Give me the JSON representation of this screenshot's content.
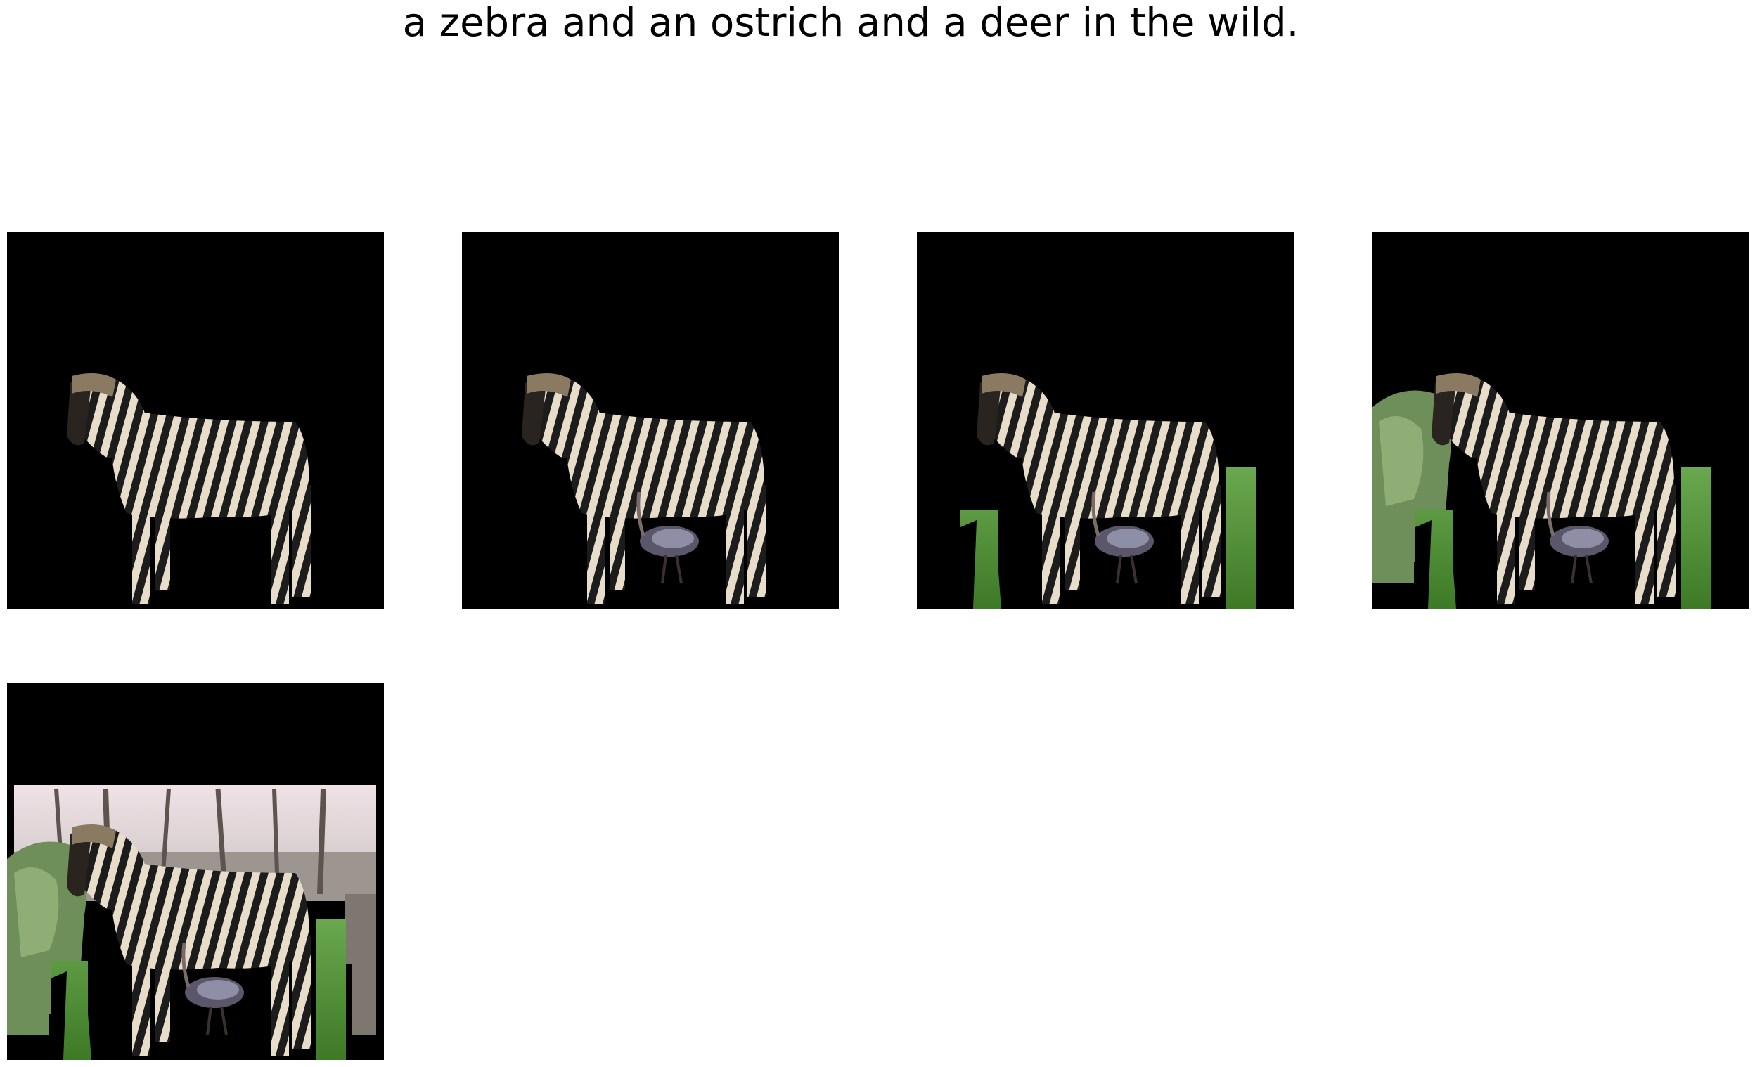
{
  "caption": "a zebra and an ostrich and a deer in the wild.",
  "panels": [
    {
      "id": "p1",
      "layers": [
        "zebra"
      ]
    },
    {
      "id": "p2",
      "layers": [
        "zebra",
        "ostrich"
      ]
    },
    {
      "id": "p3",
      "layers": [
        "grass",
        "zebra",
        "ostrich"
      ]
    },
    {
      "id": "p4",
      "layers": [
        "bush",
        "grass",
        "zebra",
        "ostrich"
      ]
    },
    {
      "id": "p5",
      "layers": [
        "woods",
        "bush",
        "grass",
        "zebra",
        "ostrich"
      ]
    }
  ],
  "colors": {
    "mask": "#000000",
    "zebra_light": "#e8dccb",
    "zebra_dark": "#1c1c1c",
    "grass": "#4f8f2f",
    "bush": "#6f8f5a",
    "sky": "#e8d8dc",
    "trees": "#7a6f66",
    "ostrich": "#5b566a"
  }
}
